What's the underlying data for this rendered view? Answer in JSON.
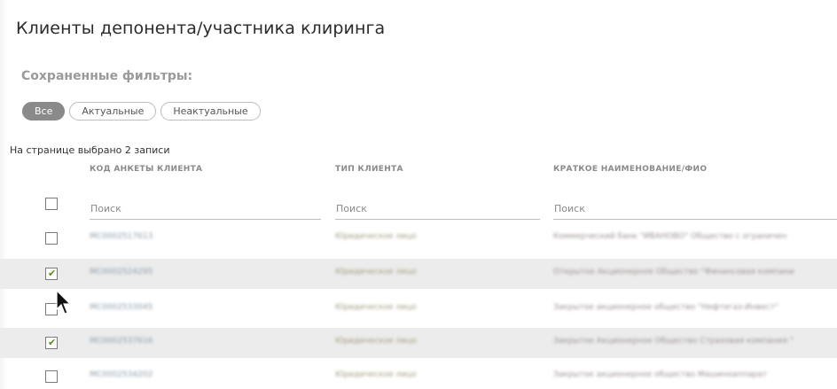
{
  "page": {
    "title": "Клиенты депонента/участника клиринга"
  },
  "filters": {
    "label": "Сохраненные фильтры:",
    "items": [
      {
        "label": "Все",
        "active": true
      },
      {
        "label": "Актуальные",
        "active": false
      },
      {
        "label": "Неактуальные",
        "active": false
      }
    ]
  },
  "selection_info": "На странице выбрано 2 записи",
  "table": {
    "columns": [
      {
        "key": "code",
        "header": "КОД АНКЕТЫ КЛИЕНТА",
        "search_placeholder": "Поиск"
      },
      {
        "key": "type",
        "header": "ТИП КЛИЕНТА",
        "search_placeholder": "Поиск"
      },
      {
        "key": "name",
        "header": "КРАТКОЕ НАИМЕНОВАНИЕ/ФИО",
        "search_placeholder": "Поиск"
      }
    ],
    "rows": [
      {
        "code": "MC0002517613",
        "type": "Юридическое лицо",
        "name": "Коммерческий банк \"ИВАНОВО\" Общество с ограничен",
        "checked": false
      },
      {
        "code": "MC0002524295",
        "type": "Юридическое лицо",
        "name": "Открытое Акционерное Общество \"Финансовая компани",
        "checked": true
      },
      {
        "code": "MC0002533045",
        "type": "Юридическое лицо",
        "name": "Закрытое акционерное общество \"Нефтегаз-Инвест\"",
        "checked": false
      },
      {
        "code": "MC0002537616",
        "type": "Юридическое лицо",
        "name": "Закрытое Акционерное Общество Страховая компания \"",
        "checked": true
      },
      {
        "code": "MC0002534202",
        "type": "Юридическое лицо",
        "name": "Закрытое акционерное общество Машиноаппарат",
        "checked": false
      }
    ]
  },
  "icons": {
    "checkmark": "checkmark-icon",
    "cursor": "mouse-pointer-icon"
  },
  "colors": {
    "active_filter": "#8a8a8a",
    "checkmark": "#5a8a1e",
    "row_highlight": "#ececec"
  }
}
